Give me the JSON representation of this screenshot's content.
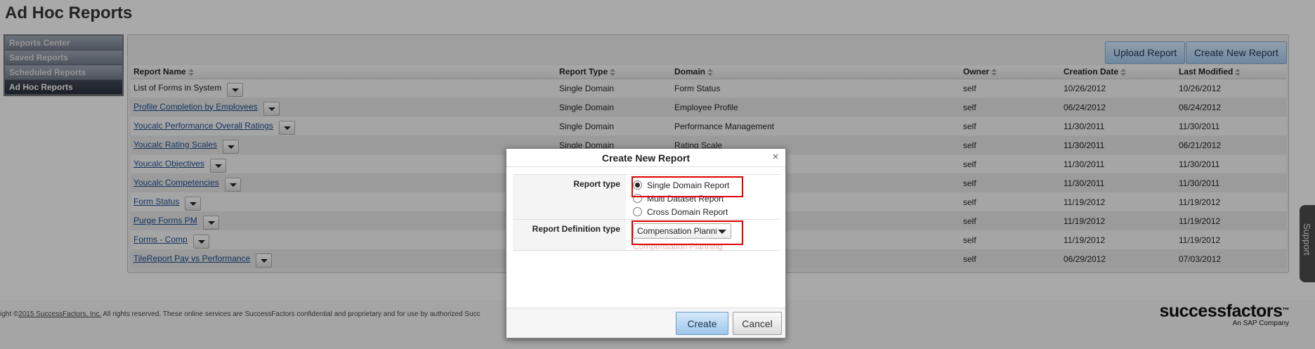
{
  "page": {
    "title": "Ad Hoc Reports"
  },
  "nav": {
    "items": [
      {
        "label": "Reports Center"
      },
      {
        "label": "Saved Reports"
      },
      {
        "label": "Scheduled Reports"
      },
      {
        "label": "Ad Hoc Reports",
        "active": true
      }
    ]
  },
  "toolbar": {
    "upload_label": "Upload Report",
    "create_label": "Create New Report"
  },
  "table": {
    "columns": [
      "Report Name",
      "Report Type",
      "Domain",
      "Owner",
      "Creation Date",
      "Last Modified"
    ],
    "rows": [
      {
        "name": "List of Forms in System",
        "type": "Single Domain",
        "domain": "Form Status",
        "owner": "self",
        "created": "10/26/2012",
        "modified": "10/26/2012"
      },
      {
        "name": "Profile Completion by Employees",
        "type": "Single Domain",
        "domain": "Employee Profile",
        "owner": "self",
        "created": "06/24/2012",
        "modified": "06/24/2012"
      },
      {
        "name": "Youcalc Performance Overall Ratings",
        "type": "Single Domain",
        "domain": "Performance Management",
        "owner": "self",
        "created": "11/30/2011",
        "modified": "11/30/2011"
      },
      {
        "name": "Youcalc Rating Scales",
        "type": "Single Domain",
        "domain": "Rating Scale",
        "owner": "self",
        "created": "11/30/2011",
        "modified": "06/21/2012"
      },
      {
        "name": "Youcalc Objectives",
        "type": "",
        "domain": "",
        "owner": "self",
        "created": "11/30/2011",
        "modified": "11/30/2011"
      },
      {
        "name": "Youcalc Competencies",
        "type": "",
        "domain": "",
        "owner": "self",
        "created": "11/30/2011",
        "modified": "11/30/2011"
      },
      {
        "name": "Form Status",
        "type": "",
        "domain": "",
        "owner": "self",
        "created": "11/19/2012",
        "modified": "11/19/2012"
      },
      {
        "name": "Purge Forms PM",
        "type": "",
        "domain": "",
        "owner": "self",
        "created": "11/19/2012",
        "modified": "11/19/2012"
      },
      {
        "name": "Forms - Comp",
        "type": "",
        "domain": "",
        "owner": "self",
        "created": "11/19/2012",
        "modified": "11/19/2012"
      },
      {
        "name": "TileReport Pay vs Performance",
        "type": "",
        "domain": "",
        "owner": "self",
        "created": "06/29/2012",
        "modified": "07/03/2012"
      }
    ]
  },
  "footer": {
    "copyright_prefix": "ight ©",
    "copyright_link": "2015 SuccessFactors, Inc.",
    "copyright_suffix": " All rights reserved. These online services are SuccessFactors confidential and proprietary and for use by authorized Succ",
    "brand": "successfactors",
    "brand_tm": "™",
    "brand_sub": "An SAP Company"
  },
  "support": {
    "label": "Support"
  },
  "dialog": {
    "title": "Create New Report",
    "close_glyph": "×",
    "report_type_label": "Report type",
    "report_type_options": [
      {
        "label": "Single Domain Report",
        "checked": true
      },
      {
        "label": "Multi Dataset Report",
        "checked": false
      },
      {
        "label": "Cross Domain Report",
        "checked": false
      }
    ],
    "definition_label": "Report Definition type",
    "definition_value": "Compensation Planning",
    "definition_ghost": "Compensation Planning",
    "create_label": "Create",
    "cancel_label": "Cancel"
  },
  "colors": {
    "accent_button": "#9fc4e6",
    "highlight": "#e00000",
    "nav_active": "#2a303c",
    "link": "#1a4a8a"
  },
  "icons": [
    "sort-icon",
    "menu-dropdown-icon",
    "close-icon",
    "select-arrow-icon"
  ]
}
